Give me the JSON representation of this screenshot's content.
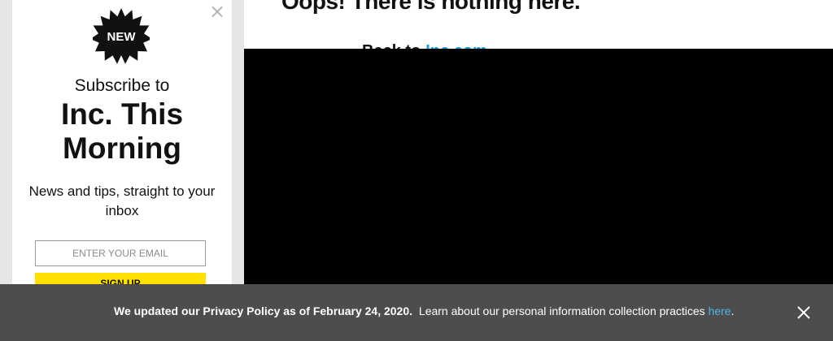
{
  "main": {
    "heading": "Oops! There is nothing here.",
    "back_prefix": "Back to",
    "back_link": "Inc.com"
  },
  "subscribe": {
    "badge": "NEW",
    "close_glyph": "×",
    "subscribe_to": "Subscribe to",
    "title": "Inc. This Morning",
    "description": "News and tips, straight to your inbox",
    "email_placeholder": "ENTER YOUR EMAIL",
    "signup_label": "SIGN UP"
  },
  "privacy_banner": {
    "bold_text": "We updated our Privacy Policy as of February 24, 2020.",
    "text": "Learn about our personal information collection practices",
    "link_text": "here",
    "trailing": "."
  },
  "colors": {
    "accent_yellow": "#ffe000",
    "link_blue": "#1a9ad6",
    "banner_bg": "#4d4d4d"
  },
  "icons": {
    "badge": "starburst-badge-icon",
    "panel_close": "close-icon",
    "banner_close": "close-icon"
  }
}
